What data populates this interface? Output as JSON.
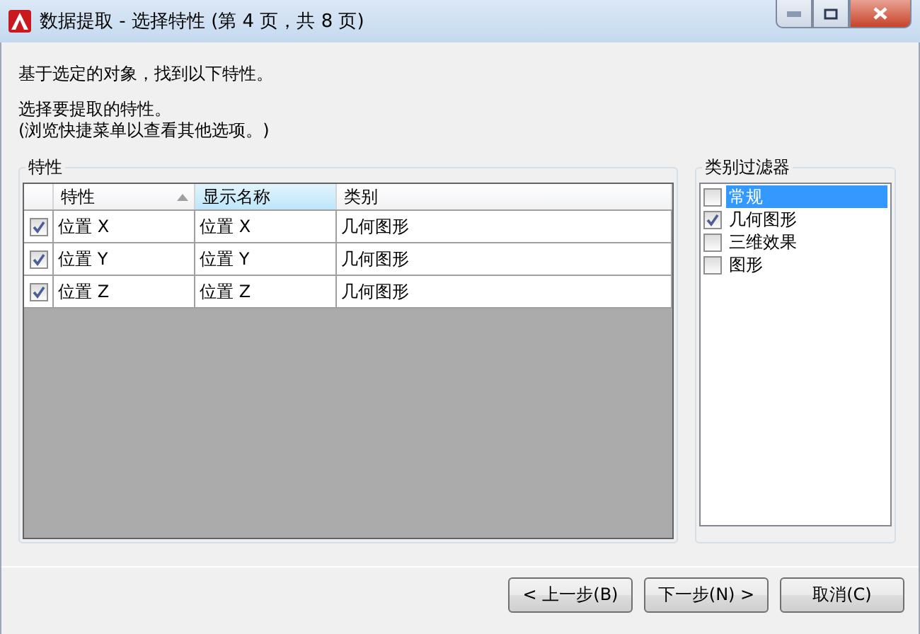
{
  "window": {
    "title": "数据提取 - 选择特性 (第 4 页，共 8 页)"
  },
  "intro": "基于选定的对象，找到以下特性。",
  "instruction": "选择要提取的特性。",
  "hint": "(浏览快捷菜单以查看其他选项。)",
  "properties_group": {
    "title": "特性",
    "columns": [
      {
        "label": "特性",
        "sorted": true,
        "highlighted": false
      },
      {
        "label": "显示名称",
        "sorted": false,
        "highlighted": true
      },
      {
        "label": "类别",
        "sorted": false,
        "highlighted": false
      }
    ],
    "rows": [
      {
        "checked": true,
        "cells": [
          "位置 X",
          "位置 X",
          "几何图形"
        ]
      },
      {
        "checked": true,
        "cells": [
          "位置 Y",
          "位置 Y",
          "几何图形"
        ]
      },
      {
        "checked": true,
        "cells": [
          "位置 Z",
          "位置 Z",
          "几何图形"
        ]
      }
    ]
  },
  "category_filter": {
    "title": "类别过滤器",
    "items": [
      {
        "label": "常规",
        "checked": false,
        "selected": true
      },
      {
        "label": "几何图形",
        "checked": true,
        "selected": false
      },
      {
        "label": "三维效果",
        "checked": false,
        "selected": false
      },
      {
        "label": "图形",
        "checked": false,
        "selected": false
      }
    ]
  },
  "buttons": [
    "< 上一步(B)",
    "下一步(N) >",
    "取消(C)"
  ]
}
